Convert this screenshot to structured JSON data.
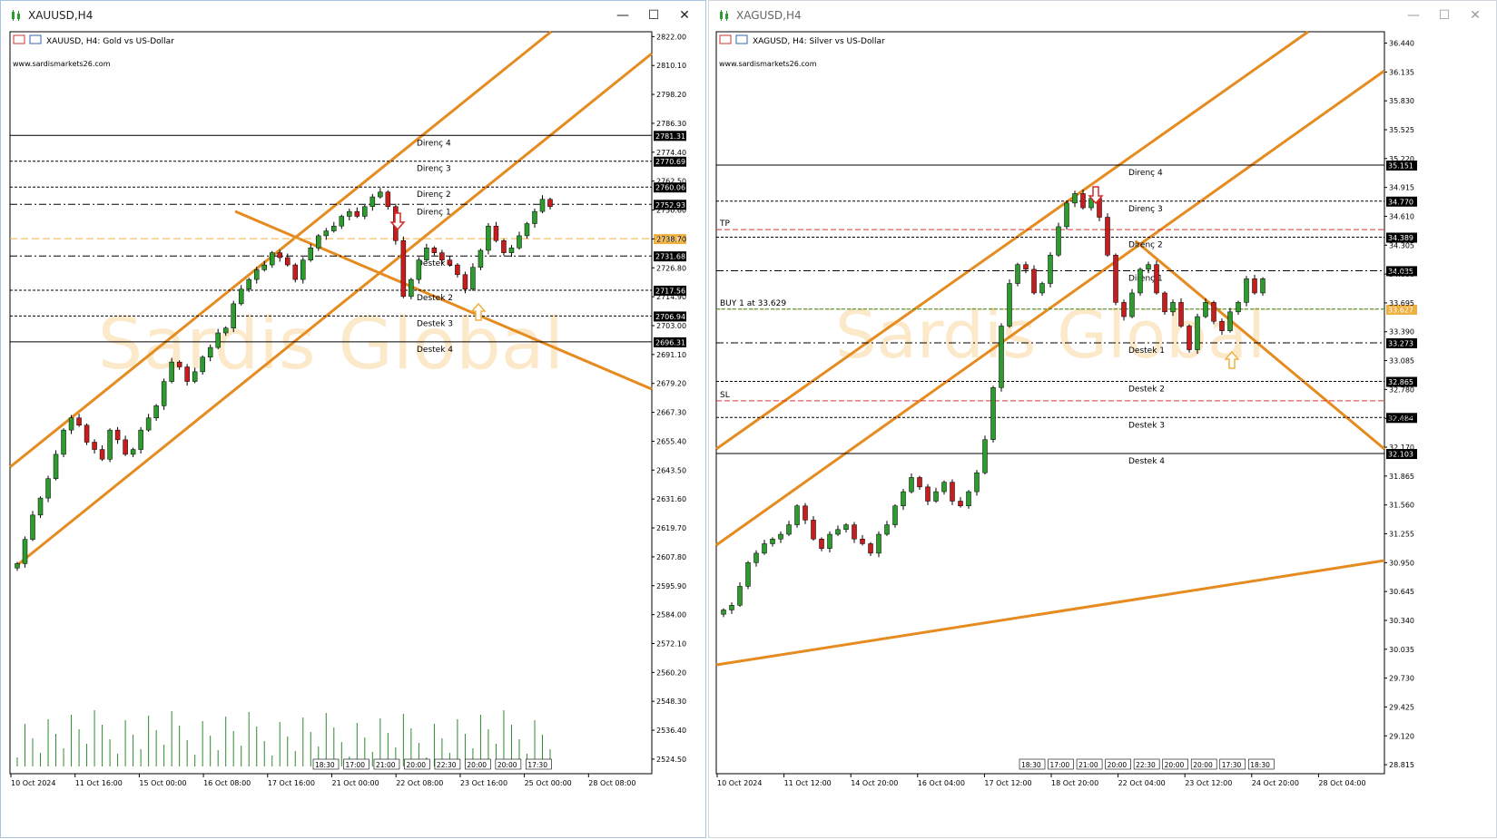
{
  "colors": {
    "bull": "#2e9b2e",
    "bear": "#c81d1d",
    "channel": "#e58b1f",
    "volume": "#2e8b2e",
    "grid": "#000000",
    "accent": "#f0b040",
    "red_arrow": "#d12b2b"
  },
  "windows": [
    {
      "title": "XAUUSD,H4",
      "header": "XAUUSD, H4:  Gold vs US-Dollar",
      "watermark_site": "www.sardismarkets26.com",
      "watermark": "Sardis Global",
      "price_axis": {
        "min": 2518.5,
        "max": 2824.0,
        "labels": [
          "2822.00",
          "2810.10",
          "2798.20",
          "2786.30",
          "2774.40",
          "2762.50",
          "2750.60",
          "2738.70",
          "2726.80",
          "2714.90",
          "2703.00",
          "2691.10",
          "2679.20",
          "2667.30",
          "2655.40",
          "2643.50",
          "2631.60",
          "2619.70",
          "2607.80",
          "2595.90",
          "2584.00",
          "2572.10",
          "2560.20",
          "2548.30",
          "2536.40",
          "2524.50"
        ]
      },
      "levels": [
        {
          "price": 2781.31,
          "label": "Direnç 4",
          "tag": "2781.31",
          "style": "solid"
        },
        {
          "price": 2770.69,
          "label": "Direnç 3",
          "tag": "2770.69",
          "style": "dash"
        },
        {
          "price": 2760.06,
          "label": "Direnç 2",
          "tag": "2760.06",
          "style": "dash"
        },
        {
          "price": 2752.93,
          "label": "Direnç 1",
          "tag": "2752.93",
          "style": "dashdot"
        },
        {
          "price": 2738.81,
          "label": "",
          "tag": "2738.81",
          "style": "orange"
        },
        {
          "price": 2731.68,
          "label": "Destek 1",
          "tag": "2731.68",
          "style": "dashdot"
        },
        {
          "price": 2717.56,
          "label": "Destek 2",
          "tag": "2717.56",
          "style": "dash"
        },
        {
          "price": 2706.94,
          "label": "Destek 3",
          "tag": "2706.94",
          "style": "dash"
        },
        {
          "price": 2696.31,
          "label": "Destek 4",
          "tag": "2696.31",
          "style": "solid"
        }
      ],
      "time_labels": [
        "10 Oct 2024",
        "11 Oct 16:00",
        "15 Oct 00:00",
        "16 Oct 08:00",
        "17 Oct 16:00",
        "21 Oct 00:00",
        "22 Oct 08:00",
        "23 Oct 16:00",
        "25 Oct 00:00",
        "28 Oct 08:00"
      ],
      "session_labels": [
        "18:30",
        "17:00",
        "21:00",
        "20:00",
        "22:30",
        "20:00",
        "20:00",
        "17:30"
      ]
    },
    {
      "title": "XAGUSD,H4",
      "header": "XAGUSD, H4:  Silver vs US-Dollar",
      "watermark_site": "www.sardismarkets26.com",
      "watermark": "Sardis Global",
      "price_axis": {
        "min": 28.72,
        "max": 36.56,
        "labels": [
          "36.440",
          "36.135",
          "35.830",
          "35.525",
          "35.220",
          "34.915",
          "34.610",
          "34.305",
          "34.000",
          "33.695",
          "33.390",
          "33.085",
          "32.780",
          "32.475",
          "32.170",
          "31.865",
          "31.560",
          "31.255",
          "30.950",
          "30.645",
          "30.340",
          "30.035",
          "29.730",
          "29.425",
          "29.120",
          "28.815"
        ]
      },
      "levels": [
        {
          "price": 35.151,
          "label": "Direnç 4",
          "tag": "35.151",
          "style": "solid"
        },
        {
          "price": 34.77,
          "label": "Direnç 3",
          "tag": "34.770",
          "style": "dash"
        },
        {
          "price": 34.389,
          "label": "Direnç 2",
          "tag": "34.389",
          "style": "dash"
        },
        {
          "price": 34.035,
          "label": "Direnç 1",
          "tag": "34.035",
          "style": "dashdot"
        },
        {
          "price": 33.627,
          "label": "",
          "tag": "33.627",
          "style": "orange"
        },
        {
          "price": 33.273,
          "label": "Destek 1",
          "tag": "33.273",
          "style": "dashdot"
        },
        {
          "price": 32.865,
          "label": "Destek 2",
          "tag": "32.865",
          "style": "dash"
        },
        {
          "price": 32.484,
          "label": "Destek 3",
          "tag": "32.484",
          "style": "dash"
        },
        {
          "price": 32.103,
          "label": "Destek 4",
          "tag": "32.103",
          "style": "solid"
        }
      ],
      "trade": {
        "tp_label": "TP",
        "tp_price": 34.47,
        "sl_label": "SL",
        "sl_price": 32.66,
        "buy_label": "BUY 1 at 33.629",
        "buy_price": 33.629
      },
      "time_labels": [
        "10 Oct 2024",
        "11 Oct 12:00",
        "14 Oct 20:00",
        "16 Oct 04:00",
        "17 Oct 12:00",
        "18 Oct 20:00",
        "22 Oct 04:00",
        "23 Oct 12:00",
        "24 Oct 20:00",
        "28 Oct 04:00"
      ],
      "session_labels": [
        "18:30",
        "17:00",
        "21:00",
        "20:00",
        "22:30",
        "20:00",
        "20:00",
        "17:30",
        "18:30"
      ]
    }
  ],
  "chart_data": [
    {
      "type": "candlestick",
      "title": "XAUUSD, H4: Gold vs US-Dollar",
      "ylim": [
        2518.5,
        2824.0
      ],
      "candles_close": [
        2605,
        2615,
        2625,
        2632,
        2640,
        2650,
        2660,
        2665,
        2662,
        2655,
        2652,
        2648,
        2660,
        2656,
        2650,
        2652,
        2660,
        2665,
        2670,
        2680,
        2688,
        2686,
        2680,
        2684,
        2690,
        2694,
        2700,
        2702,
        2712,
        2718,
        2722,
        2726,
        2728,
        2733,
        2731,
        2728,
        2722,
        2730,
        2735,
        2740,
        2742,
        2744,
        2748,
        2750,
        2748,
        2752,
        2756,
        2758,
        2752,
        2738,
        2715,
        2722,
        2730,
        2735,
        2733,
        2730,
        2728,
        2724,
        2718,
        2727,
        2734,
        2744,
        2738,
        2733,
        2735,
        2740,
        2745,
        2750,
        2755,
        2752
      ],
      "volume_note": "per-bar tick volume histogram"
    },
    {
      "type": "candlestick",
      "title": "XAGUSD, H4: Silver vs US-Dollar",
      "ylim": [
        28.72,
        36.56
      ],
      "candles_close": [
        30.45,
        30.5,
        30.7,
        30.95,
        31.05,
        31.15,
        31.2,
        31.25,
        31.35,
        31.55,
        31.4,
        31.2,
        31.1,
        31.25,
        31.3,
        31.35,
        31.2,
        31.15,
        31.05,
        31.25,
        31.35,
        31.55,
        31.7,
        31.85,
        31.75,
        31.6,
        31.7,
        31.8,
        31.6,
        31.55,
        31.7,
        31.9,
        32.25,
        32.8,
        33.45,
        33.9,
        34.1,
        34.05,
        33.8,
        33.9,
        34.2,
        34.5,
        34.75,
        34.85,
        34.7,
        34.8,
        34.6,
        34.2,
        33.7,
        33.55,
        33.8,
        34.05,
        34.1,
        33.8,
        33.6,
        33.7,
        33.45,
        33.2,
        33.55,
        33.7,
        33.5,
        33.4,
        33.6,
        33.7,
        33.95,
        33.8,
        33.95
      ]
    }
  ]
}
